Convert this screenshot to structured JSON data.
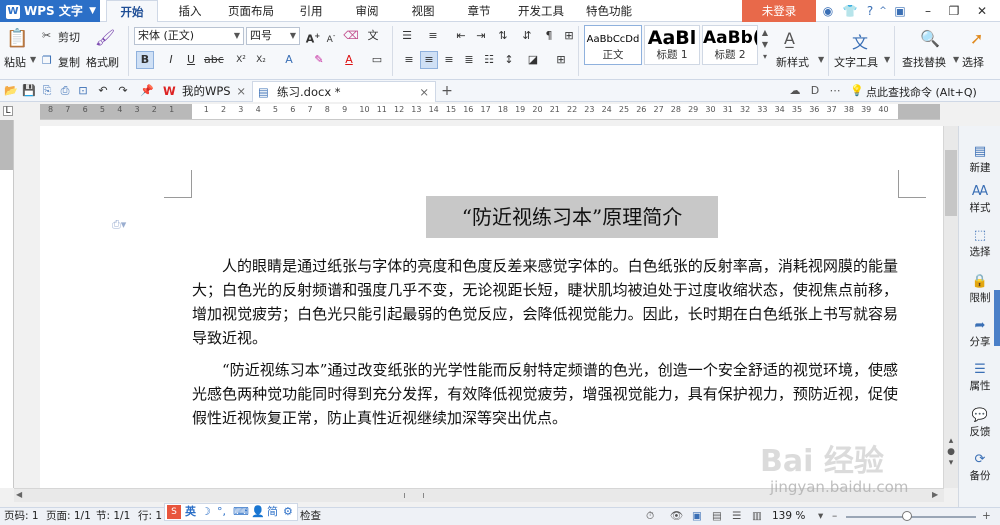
{
  "app": {
    "name": "WPS 文字",
    "logo_letter": "W"
  },
  "ribbon_tabs": [
    "开始",
    "插入",
    "页面布局",
    "引用",
    "审阅",
    "视图",
    "章节",
    "开发工具",
    "特色功能"
  ],
  "login_label": "未登录",
  "clipboard": {
    "paste": "粘贴",
    "cut": "剪切",
    "copy": "复制",
    "format_painter": "格式刷"
  },
  "font": {
    "name": "宋体 (正文)",
    "size": "四号",
    "bold": "B",
    "italic": "I",
    "underline": "U",
    "grow": "A",
    "shrink": "A"
  },
  "styles": [
    {
      "preview": "AaBbCcDd",
      "name": "正文"
    },
    {
      "preview": "AaBl",
      "name": "标题 1"
    },
    {
      "preview": "AaBb(",
      "name": "标题 2"
    }
  ],
  "ribbon_right": {
    "new_style": "新样式",
    "text_tools": "文字工具",
    "find_replace": "查找替换",
    "select": "选择"
  },
  "doc_tabs": [
    {
      "label": "我的WPS",
      "active": false
    },
    {
      "label": "练习.docx *",
      "active": true
    }
  ],
  "command_search": "点此查找命令 (Alt+Q)",
  "ruler_numbers": [
    "8",
    "7",
    "6",
    "5",
    "4",
    "3",
    "2",
    "1",
    "",
    "1",
    "2",
    "3",
    "4",
    "5",
    "6",
    "7",
    "8",
    "9",
    "10",
    "11",
    "12",
    "13",
    "14",
    "15",
    "16",
    "17",
    "18",
    "19",
    "20",
    "21",
    "22",
    "23",
    "24",
    "25",
    "26",
    "27",
    "28",
    "29",
    "30",
    "31",
    "32",
    "33",
    "34",
    "35",
    "36",
    "37",
    "38",
    "39",
    "40"
  ],
  "document": {
    "title": "“防近视练习本”原理简介",
    "paragraphs": [
      "人的眼睛是通过纸张与字体的亮度和色度反差来感觉字体的。白色纸张的反射率高，消耗视网膜的能量大；白色光的反射频谱和强度几乎不变，无论视距长短，睫状肌均被迫处于过度收缩状态，使视焦点前移，增加视觉疲劳；白色光只能引起最弱的色觉反应，会降低视觉能力。因此，长时期在白色纸张上书写就容易导致近视。",
      "“防近视练习本”通过改变纸张的光学性能而反射特定频谱的色光，创造一个安全舒适的视觉环境，使感光感色两种觉功能同时得到充分发挥，有效降低视觉疲劳，增强视觉能力，具有保护视力，预防近视，促使假性近视恢复正常，防止真性近视继续加深等突出优点。"
    ]
  },
  "right_panel": [
    "新建",
    "样式",
    "选择",
    "限制",
    "分享",
    "属性",
    "反馈",
    "备份"
  ],
  "status": {
    "page_code": "页码: 1",
    "pages": "页面: 1/1",
    "section": "节: 1/1",
    "row": "行: 1",
    "check": "检查",
    "zoom": "139 %"
  },
  "ime": {
    "mode": "英",
    "simplified": "简"
  },
  "watermark": {
    "brand": "Bai 经验",
    "url": "jingyan.baidu.com"
  }
}
